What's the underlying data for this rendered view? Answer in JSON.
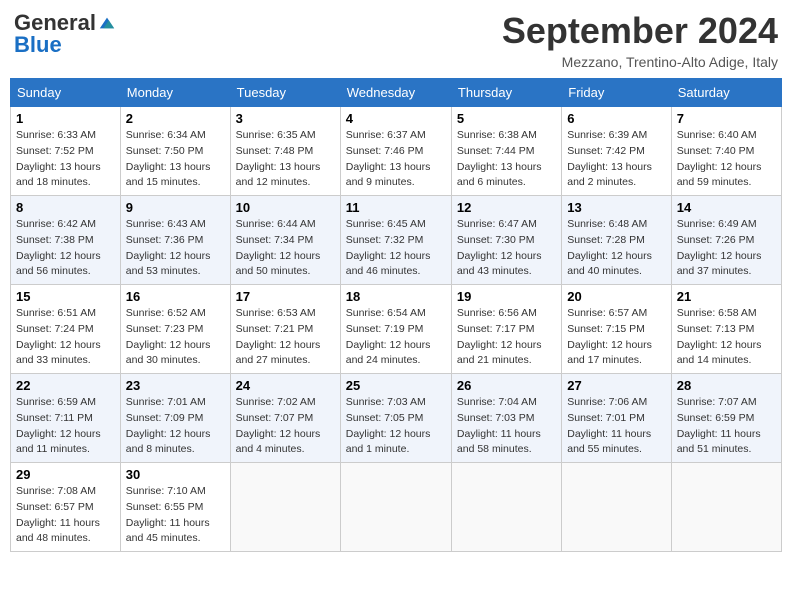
{
  "header": {
    "logo_general": "General",
    "logo_blue": "Blue",
    "month_title": "September 2024",
    "subtitle": "Mezzano, Trentino-Alto Adige, Italy"
  },
  "days_of_week": [
    "Sunday",
    "Monday",
    "Tuesday",
    "Wednesday",
    "Thursday",
    "Friday",
    "Saturday"
  ],
  "weeks": [
    [
      {
        "day": "1",
        "sunrise": "6:33 AM",
        "sunset": "7:52 PM",
        "daylight": "13 hours and 18 minutes."
      },
      {
        "day": "2",
        "sunrise": "6:34 AM",
        "sunset": "7:50 PM",
        "daylight": "13 hours and 15 minutes."
      },
      {
        "day": "3",
        "sunrise": "6:35 AM",
        "sunset": "7:48 PM",
        "daylight": "13 hours and 12 minutes."
      },
      {
        "day": "4",
        "sunrise": "6:37 AM",
        "sunset": "7:46 PM",
        "daylight": "13 hours and 9 minutes."
      },
      {
        "day": "5",
        "sunrise": "6:38 AM",
        "sunset": "7:44 PM",
        "daylight": "13 hours and 6 minutes."
      },
      {
        "day": "6",
        "sunrise": "6:39 AM",
        "sunset": "7:42 PM",
        "daylight": "13 hours and 2 minutes."
      },
      {
        "day": "7",
        "sunrise": "6:40 AM",
        "sunset": "7:40 PM",
        "daylight": "12 hours and 59 minutes."
      }
    ],
    [
      {
        "day": "8",
        "sunrise": "6:42 AM",
        "sunset": "7:38 PM",
        "daylight": "12 hours and 56 minutes."
      },
      {
        "day": "9",
        "sunrise": "6:43 AM",
        "sunset": "7:36 PM",
        "daylight": "12 hours and 53 minutes."
      },
      {
        "day": "10",
        "sunrise": "6:44 AM",
        "sunset": "7:34 PM",
        "daylight": "12 hours and 50 minutes."
      },
      {
        "day": "11",
        "sunrise": "6:45 AM",
        "sunset": "7:32 PM",
        "daylight": "12 hours and 46 minutes."
      },
      {
        "day": "12",
        "sunrise": "6:47 AM",
        "sunset": "7:30 PM",
        "daylight": "12 hours and 43 minutes."
      },
      {
        "day": "13",
        "sunrise": "6:48 AM",
        "sunset": "7:28 PM",
        "daylight": "12 hours and 40 minutes."
      },
      {
        "day": "14",
        "sunrise": "6:49 AM",
        "sunset": "7:26 PM",
        "daylight": "12 hours and 37 minutes."
      }
    ],
    [
      {
        "day": "15",
        "sunrise": "6:51 AM",
        "sunset": "7:24 PM",
        "daylight": "12 hours and 33 minutes."
      },
      {
        "day": "16",
        "sunrise": "6:52 AM",
        "sunset": "7:23 PM",
        "daylight": "12 hours and 30 minutes."
      },
      {
        "day": "17",
        "sunrise": "6:53 AM",
        "sunset": "7:21 PM",
        "daylight": "12 hours and 27 minutes."
      },
      {
        "day": "18",
        "sunrise": "6:54 AM",
        "sunset": "7:19 PM",
        "daylight": "12 hours and 24 minutes."
      },
      {
        "day": "19",
        "sunrise": "6:56 AM",
        "sunset": "7:17 PM",
        "daylight": "12 hours and 21 minutes."
      },
      {
        "day": "20",
        "sunrise": "6:57 AM",
        "sunset": "7:15 PM",
        "daylight": "12 hours and 17 minutes."
      },
      {
        "day": "21",
        "sunrise": "6:58 AM",
        "sunset": "7:13 PM",
        "daylight": "12 hours and 14 minutes."
      }
    ],
    [
      {
        "day": "22",
        "sunrise": "6:59 AM",
        "sunset": "7:11 PM",
        "daylight": "12 hours and 11 minutes."
      },
      {
        "day": "23",
        "sunrise": "7:01 AM",
        "sunset": "7:09 PM",
        "daylight": "12 hours and 8 minutes."
      },
      {
        "day": "24",
        "sunrise": "7:02 AM",
        "sunset": "7:07 PM",
        "daylight": "12 hours and 4 minutes."
      },
      {
        "day": "25",
        "sunrise": "7:03 AM",
        "sunset": "7:05 PM",
        "daylight": "12 hours and 1 minute."
      },
      {
        "day": "26",
        "sunrise": "7:04 AM",
        "sunset": "7:03 PM",
        "daylight": "11 hours and 58 minutes."
      },
      {
        "day": "27",
        "sunrise": "7:06 AM",
        "sunset": "7:01 PM",
        "daylight": "11 hours and 55 minutes."
      },
      {
        "day": "28",
        "sunrise": "7:07 AM",
        "sunset": "6:59 PM",
        "daylight": "11 hours and 51 minutes."
      }
    ],
    [
      {
        "day": "29",
        "sunrise": "7:08 AM",
        "sunset": "6:57 PM",
        "daylight": "11 hours and 48 minutes."
      },
      {
        "day": "30",
        "sunrise": "7:10 AM",
        "sunset": "6:55 PM",
        "daylight": "11 hours and 45 minutes."
      },
      null,
      null,
      null,
      null,
      null
    ]
  ]
}
